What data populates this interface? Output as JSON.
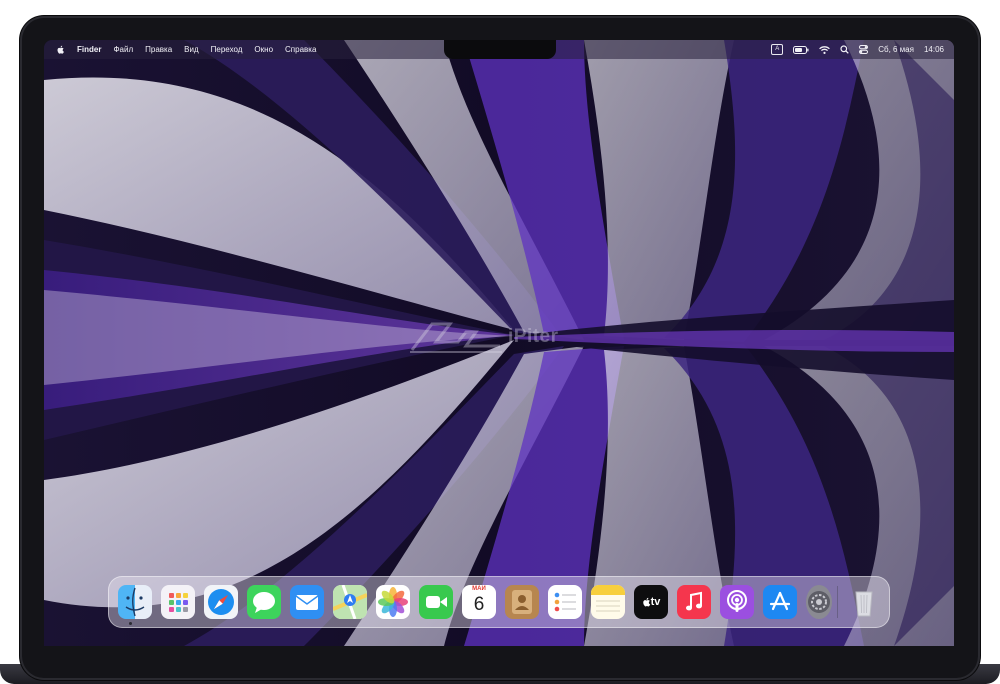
{
  "menubar": {
    "app_name": "Finder",
    "menus": [
      "Файл",
      "Правка",
      "Вид",
      "Переход",
      "Окно",
      "Справка"
    ],
    "input_source": "A",
    "date": "Сб, 6 мая",
    "time": "14:06"
  },
  "watermark": {
    "text": "iPiter"
  },
  "dock": {
    "apps": [
      {
        "name": "Finder",
        "icon": "finder-icon"
      },
      {
        "name": "Launchpad",
        "icon": "launchpad-icon"
      },
      {
        "name": "Safari",
        "icon": "safari-icon"
      },
      {
        "name": "Messages",
        "icon": "messages-icon"
      },
      {
        "name": "Mail",
        "icon": "mail-icon"
      },
      {
        "name": "Maps",
        "icon": "maps-icon"
      },
      {
        "name": "Photos",
        "icon": "photos-icon"
      },
      {
        "name": "FaceTime",
        "icon": "facetime-icon"
      },
      {
        "name": "Calendar",
        "icon": "calendar-icon"
      },
      {
        "name": "Contacts",
        "icon": "contacts-icon"
      },
      {
        "name": "Reminders",
        "icon": "reminders-icon"
      },
      {
        "name": "Notes",
        "icon": "notes-icon"
      },
      {
        "name": "TV",
        "icon": "tv-icon"
      },
      {
        "name": "Music",
        "icon": "music-icon"
      },
      {
        "name": "Podcasts",
        "icon": "podcasts-icon"
      },
      {
        "name": "App Store",
        "icon": "app-store-icon"
      },
      {
        "name": "System Settings",
        "icon": "system-settings-icon"
      },
      {
        "name": "Trash",
        "icon": "trash-icon"
      }
    ],
    "calendar_month": "МАЙ",
    "calendar_day": "6",
    "tv_label": "tv"
  },
  "colors": {
    "wallpaper_dark": "#120b26",
    "wallpaper_purple": "#6b36c9",
    "wallpaper_light": "#d9d4e6"
  }
}
